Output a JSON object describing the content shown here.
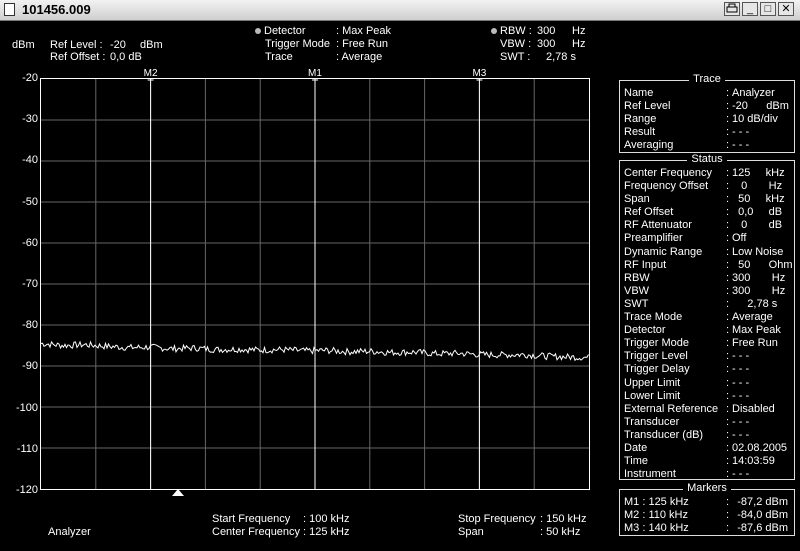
{
  "window": {
    "title": "101456.009",
    "buttons": [
      "print",
      "minimize",
      "maximize",
      "close"
    ]
  },
  "header": {
    "unit": "dBm",
    "ref_level_label": "Ref Level :",
    "ref_level_value": "-20",
    "ref_level_unit": "dBm",
    "ref_offset_label": "Ref Offset :",
    "ref_offset_value": "0,0 dB",
    "detector_label": "Detector",
    "detector_value": ": Max Peak",
    "trigger_mode_label": "Trigger Mode",
    "trigger_mode_value": ": Free Run",
    "trace_label": "Trace",
    "trace_value": ": Average",
    "rbw_label": "RBW :",
    "rbw_value": "300",
    "rbw_unit": "Hz",
    "vbw_label": "VBW :",
    "vbw_value": "300",
    "vbw_unit": "Hz",
    "swt_label": "SWT :",
    "swt_value": "2,78 s"
  },
  "chart_data": {
    "type": "line",
    "ylabel": "dBm",
    "ylim": [
      -120,
      -20
    ],
    "yticks": [
      "-20",
      "-30",
      "-40",
      "-50",
      "-60",
      "-70",
      "-80",
      "-90",
      "-100",
      "-110",
      "-120"
    ],
    "xlim_khz": [
      100,
      150
    ],
    "grid": true,
    "series": [
      {
        "x_khz": [
          100,
          102,
          104,
          106,
          108,
          110,
          112,
          114,
          116,
          118,
          120,
          122,
          124,
          126,
          128,
          130,
          132,
          134,
          136,
          138,
          140,
          142,
          144,
          146,
          148,
          150
        ],
        "values": [
          -84.5,
          -85.0,
          -84.8,
          -85.2,
          -85.5,
          -85.4,
          -85.8,
          -85.6,
          -86.0,
          -85.9,
          -86.1,
          -86.0,
          -86.3,
          -86.2,
          -86.5,
          -86.4,
          -86.7,
          -86.6,
          -87.0,
          -86.9,
          -87.2,
          -87.3,
          -87.2,
          -87.6,
          -87.8,
          -87.9
        ]
      }
    ],
    "markers": [
      {
        "name": "M1",
        "x_khz": 125
      },
      {
        "name": "M2",
        "x_khz": 110
      },
      {
        "name": "M3",
        "x_khz": 140
      }
    ]
  },
  "trace_panel": {
    "title": "Trace",
    "rows": [
      {
        "k": "Name",
        "v": "Analyzer"
      },
      {
        "k": "Ref Level",
        "v": "-20      dBm"
      },
      {
        "k": "Range",
        "v": "10 dB/div"
      },
      {
        "k": "Result",
        "v": "- - -"
      },
      {
        "k": "Averaging",
        "v": "- - -"
      }
    ]
  },
  "status_panel": {
    "title": "Status",
    "rows": [
      {
        "k": "Center Frequency",
        "v": "125     kHz"
      },
      {
        "k": "Frequency Offset",
        "v": "   0       Hz"
      },
      {
        "k": "Span",
        "v": "  50     kHz"
      },
      {
        "k": "Ref Offset",
        "v": "  0,0     dB"
      },
      {
        "k": "RF Attenuator",
        "v": "   0       dB"
      },
      {
        "k": "Preamplifier",
        "v": "Off"
      },
      {
        "k": "Dynamic Range",
        "v": "Low Noise"
      },
      {
        "k": "RF Input",
        "v": "  50      Ohm"
      },
      {
        "k": "RBW",
        "v": "300       Hz"
      },
      {
        "k": "VBW",
        "v": "300       Hz"
      },
      {
        "k": "SWT",
        "v": "     2,78 s"
      },
      {
        "k": "Trace Mode",
        "v": "Average"
      },
      {
        "k": "Detector",
        "v": "Max Peak"
      },
      {
        "k": "Trigger Mode",
        "v": "Free Run"
      },
      {
        "k": "Trigger Level",
        "v": "- - -"
      },
      {
        "k": "Trigger Delay",
        "v": "- - -"
      },
      {
        "k": "Upper Limit",
        "v": "- - -"
      },
      {
        "k": "Lower Limit",
        "v": "- - -"
      },
      {
        "k": "External Reference",
        "v": "Disabled"
      },
      {
        "k": "Transducer",
        "v": "- - -"
      },
      {
        "k": "Transducer (dB)",
        "v": "- - -"
      },
      {
        "k": "Date",
        "v": "02.08.2005"
      },
      {
        "k": "Time",
        "v": "14:03:59"
      },
      {
        "k": "Instrument",
        "v": "- - -"
      }
    ]
  },
  "markers_panel": {
    "title": "Markers",
    "rows": [
      {
        "k": "M1 : 125 kHz",
        "v": "-87,2 dBm"
      },
      {
        "k": "M2 : 110 kHz",
        "v": "-84,0 dBm"
      },
      {
        "k": "M3 : 140 kHz",
        "v": "-87,6 dBm"
      }
    ]
  },
  "footer": {
    "trace_name": "Analyzer",
    "start_freq_label": "Start Frequency",
    "start_freq_value": ": 100 kHz",
    "center_freq_label": "Center Frequency",
    "center_freq_value": ": 125 kHz",
    "stop_freq_label": "Stop Frequency",
    "stop_freq_value": ": 150 kHz",
    "span_label": "Span",
    "span_value": ":     50 kHz"
  }
}
